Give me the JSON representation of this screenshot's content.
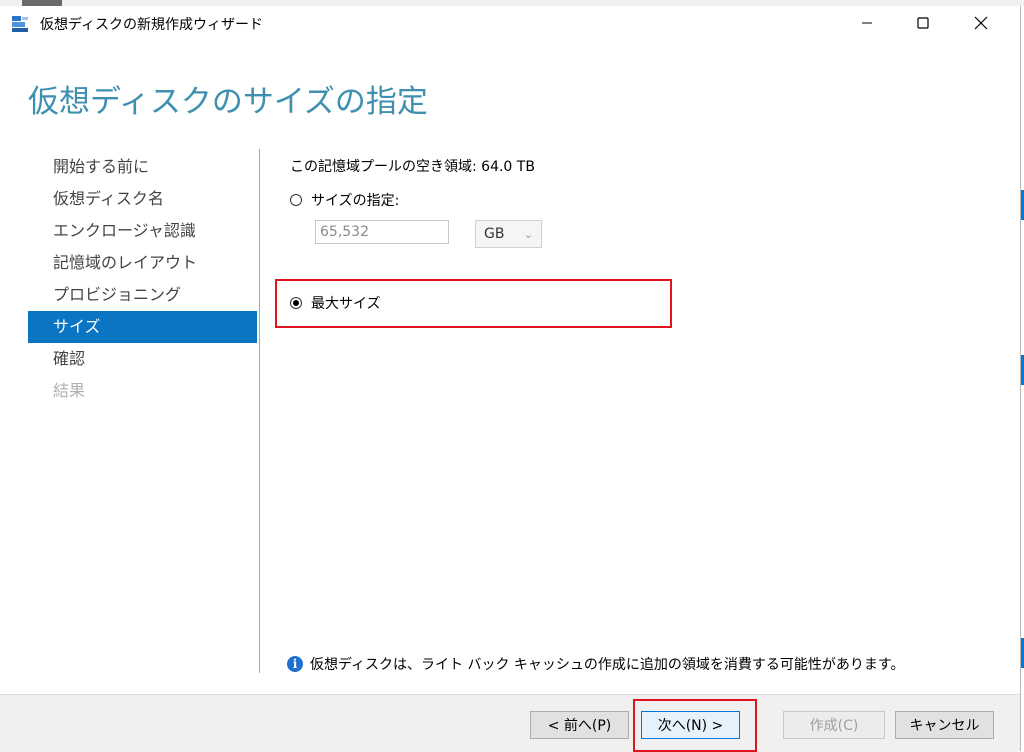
{
  "window": {
    "title": "仮想ディスクの新規作成ウィザード",
    "minimize_icon": "minimize-icon",
    "maximize_icon": "maximize-icon",
    "close_icon": "close-icon"
  },
  "page_title": "仮想ディスクのサイズの指定",
  "nav": {
    "items": [
      {
        "label": "開始する前に",
        "state": "normal"
      },
      {
        "label": "仮想ディスク名",
        "state": "normal"
      },
      {
        "label": "エンクロージャ認識",
        "state": "normal"
      },
      {
        "label": "記憶域のレイアウト",
        "state": "normal"
      },
      {
        "label": "プロビジョニング",
        "state": "normal"
      },
      {
        "label": "サイズ",
        "state": "active"
      },
      {
        "label": "確認",
        "state": "normal"
      },
      {
        "label": "結果",
        "state": "disabled"
      }
    ]
  },
  "content": {
    "free_space": "この記憶域プールの空き領域: 64.0 TB",
    "specify_size_label": "サイズの指定:",
    "specify_size_checked": false,
    "size_value": "65,532",
    "unit_value": "GB",
    "max_size_label": "最大サイズ",
    "max_size_checked": true,
    "info_text": "仮想ディスクは、ライト バック キャッシュの作成に追加の領域を消費する可能性があります。"
  },
  "footer": {
    "prev_label": "< 前へ(P)",
    "next_label": "次へ(N) >",
    "create_label": "作成(C)",
    "cancel_label": "キャンセル"
  },
  "colors": {
    "accent": "#0a75c2",
    "title": "#3f8fb0",
    "highlight": "#e0141e"
  }
}
